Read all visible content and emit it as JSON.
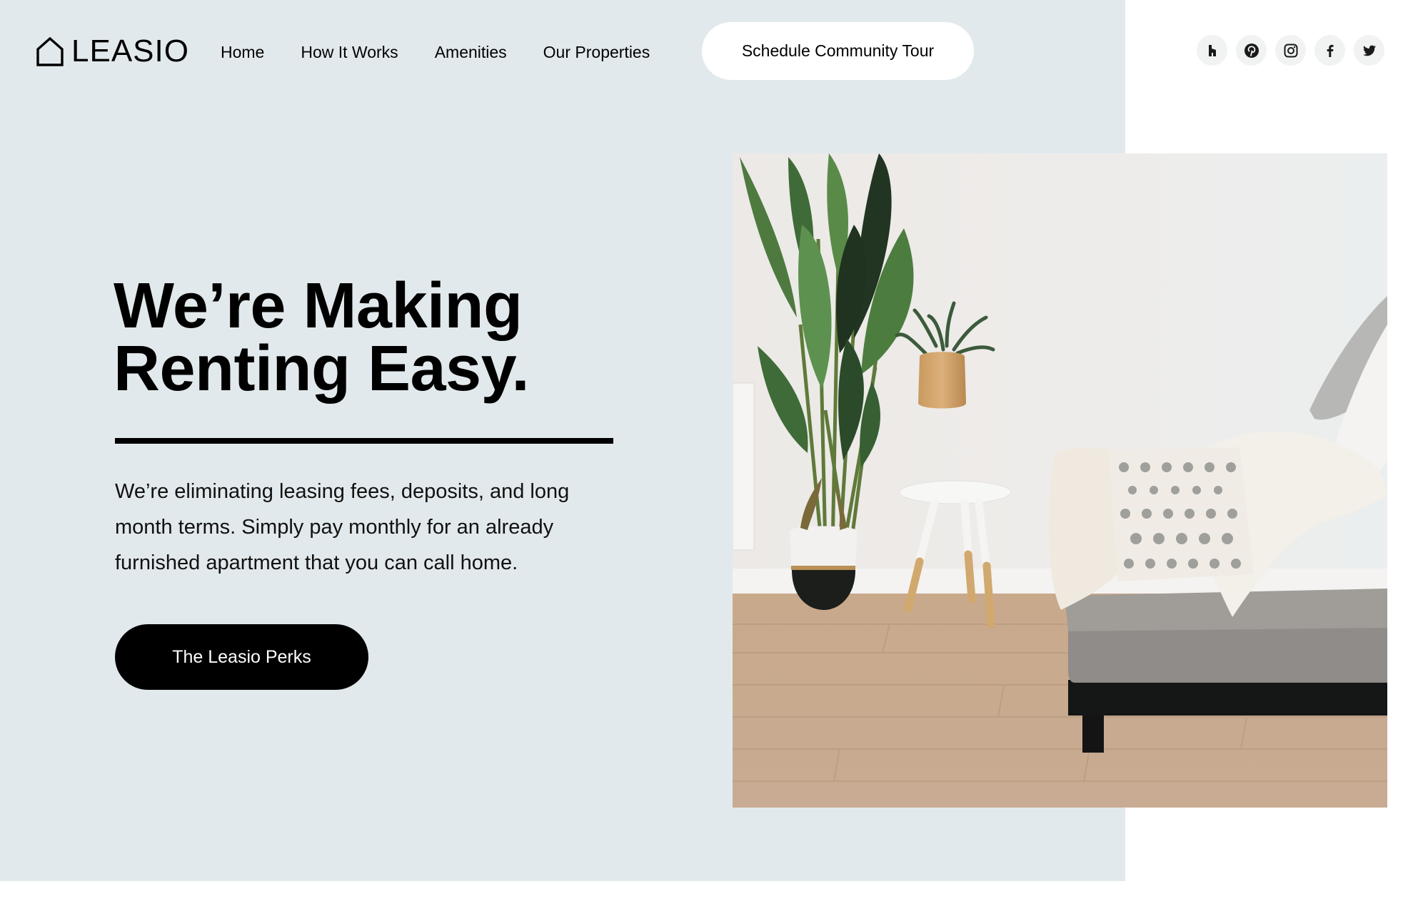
{
  "brand": {
    "name": "LEASIO",
    "logo_icon": "house-outline-icon"
  },
  "nav": {
    "items": [
      {
        "label": "Home"
      },
      {
        "label": "How It Works"
      },
      {
        "label": "Amenities"
      },
      {
        "label": "Our Properties"
      }
    ],
    "cta_label": "Schedule Community Tour"
  },
  "social": [
    {
      "name": "Houzz",
      "icon": "houzz-icon"
    },
    {
      "name": "Pinterest",
      "icon": "pinterest-icon"
    },
    {
      "name": "Instagram",
      "icon": "instagram-icon"
    },
    {
      "name": "Facebook",
      "icon": "facebook-icon"
    },
    {
      "name": "Twitter",
      "icon": "twitter-icon"
    }
  ],
  "hero": {
    "headline_lines": [
      "We’re Making",
      "Renting Easy."
    ],
    "body_lines": [
      "We’re eliminating leasing fees, deposits, and long",
      "month terms. Simply pay monthly for an already",
      "furnished apartment that you can call home."
    ],
    "button_label": "The Leasio Perks",
    "image_alt": "Furnished living room with potted bird of paradise plant, small white side table with vase, and grey sofa with throw blanket on light wood floor"
  },
  "colors": {
    "panel_bg": "#e2e9ec",
    "page_bg": "#ffffff",
    "text": "#000000",
    "primary_button": "#000000",
    "social_circle": "#f1f2f2"
  }
}
